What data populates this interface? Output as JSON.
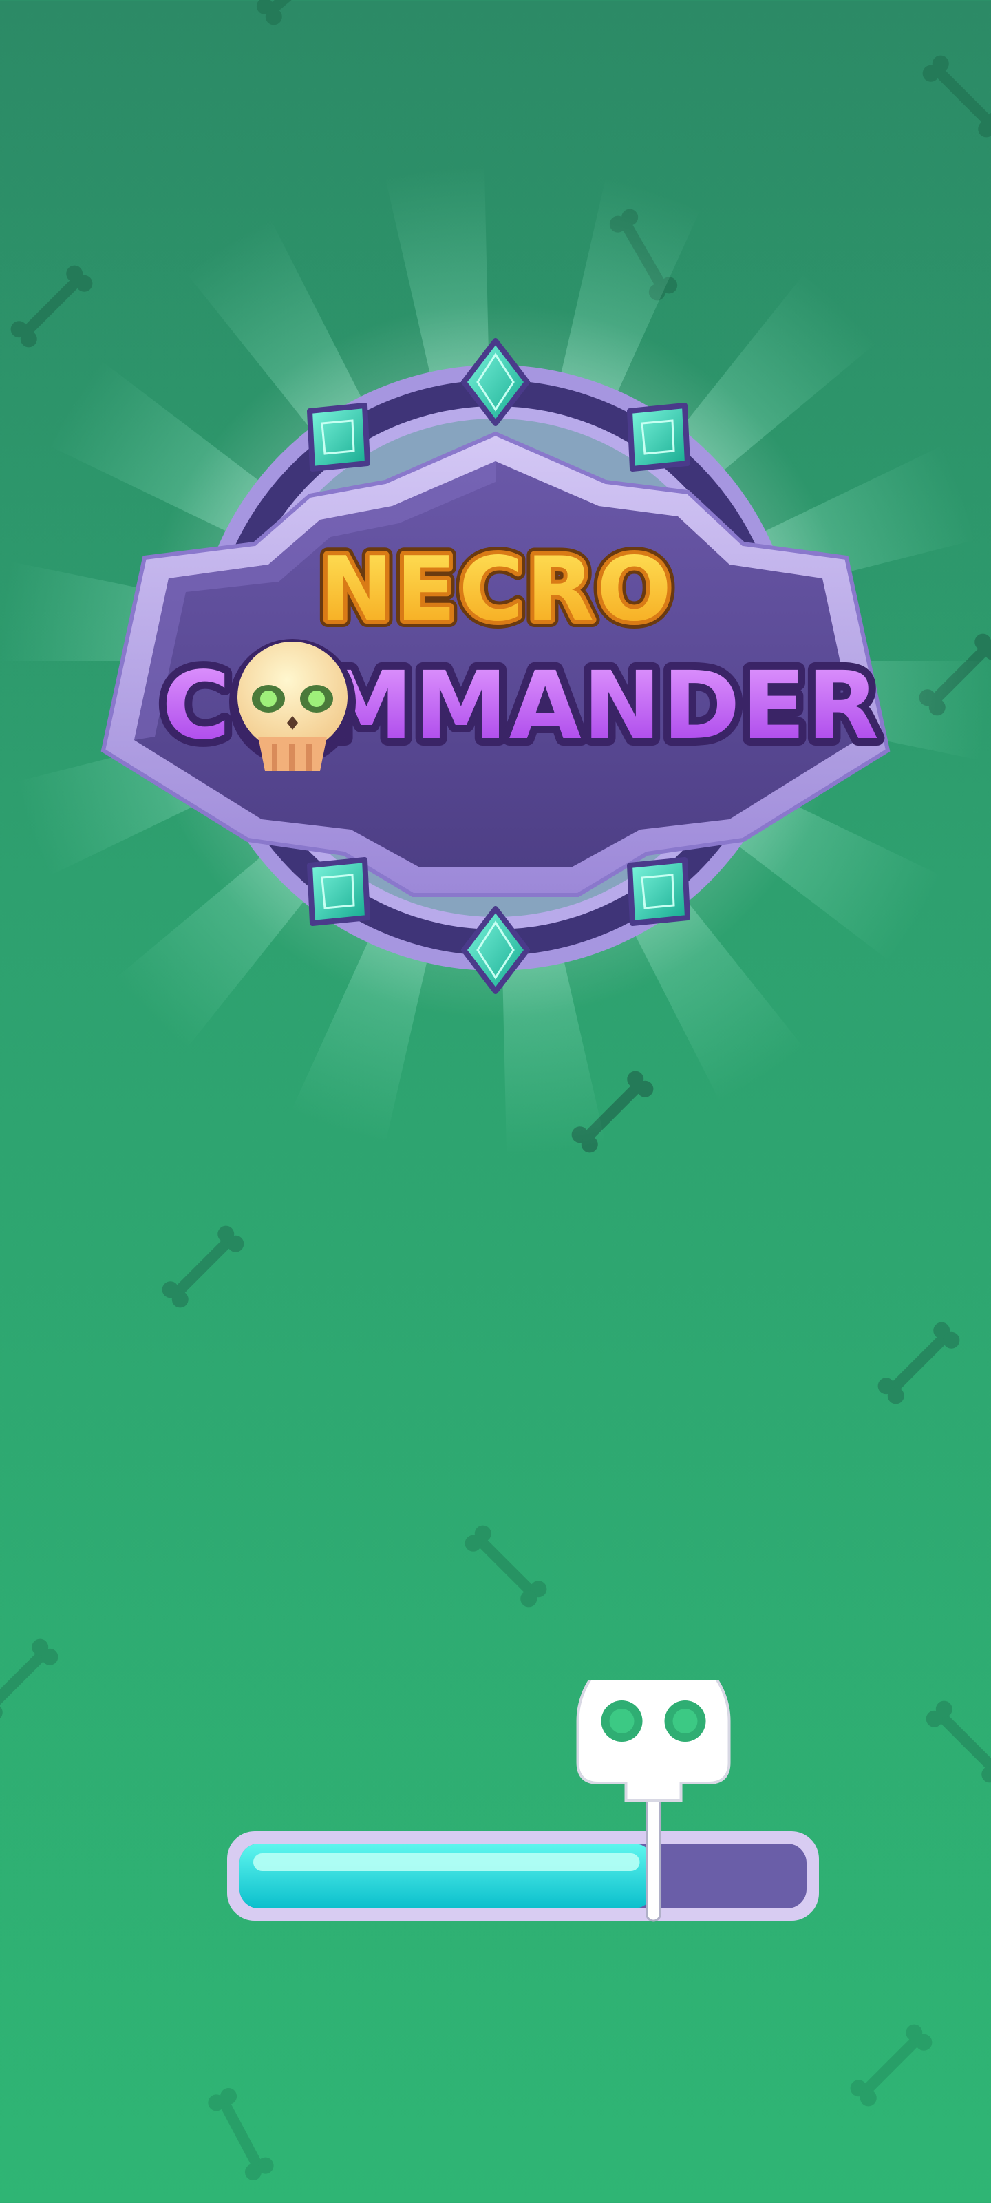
{
  "game": {
    "title_line1": "NECRO",
    "title_line2_start": "C",
    "title_line2_end": "MMANDER"
  },
  "loading": {
    "progress": 0.73
  },
  "colors": {
    "background_top": "#2c8a66",
    "background_bottom": "#2fb574",
    "panel_purple": "#5b4a93",
    "title_gold": "#ffcf2e",
    "title_violet": "#c25cf5",
    "gem_teal": "#2ed8b8",
    "bar_fill": "#18d8dc",
    "bar_track": "#6a5ea8"
  },
  "icons": [
    "bone-icon",
    "gem-icon",
    "skull-icon",
    "skull-marker-icon"
  ]
}
